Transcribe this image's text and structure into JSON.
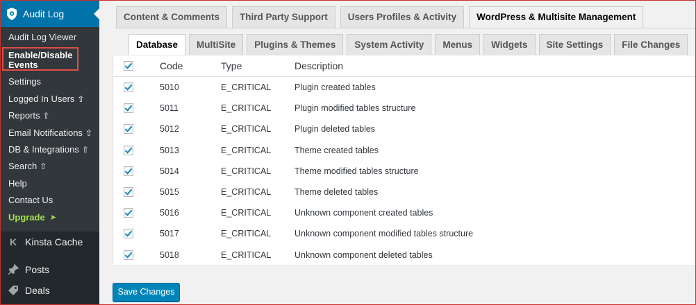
{
  "sidebar": {
    "header": "Audit Log",
    "submenu": [
      {
        "label": "Audit Log Viewer",
        "premium": false
      },
      {
        "label": "Enable/Disable Events",
        "premium": false,
        "active": true
      },
      {
        "label": "Settings",
        "premium": false
      },
      {
        "label": "Logged In Users",
        "premium": true
      },
      {
        "label": "Reports",
        "premium": true
      },
      {
        "label": "Email Notifications",
        "premium": true
      },
      {
        "label": "DB & Integrations",
        "premium": true
      },
      {
        "label": "Search",
        "premium": true
      },
      {
        "label": "Help",
        "premium": false
      },
      {
        "label": "Contact Us",
        "premium": false
      },
      {
        "label": "Upgrade",
        "premium": false,
        "upgrade": true
      }
    ],
    "kinsta": "Kinsta Cache",
    "posts": "Posts",
    "deals": "Deals"
  },
  "main_tabs": [
    {
      "label": "Content & Comments",
      "active": false
    },
    {
      "label": "Third Party Support",
      "active": false
    },
    {
      "label": "Users Profiles & Activity",
      "active": false
    },
    {
      "label": "WordPress & Multisite Management",
      "active": true
    }
  ],
  "sub_tabs": [
    {
      "label": "Database",
      "active": true
    },
    {
      "label": "MultiSite",
      "active": false
    },
    {
      "label": "Plugins & Themes",
      "active": false
    },
    {
      "label": "System Activity",
      "active": false
    },
    {
      "label": "Menus",
      "active": false
    },
    {
      "label": "Widgets",
      "active": false
    },
    {
      "label": "Site Settings",
      "active": false
    },
    {
      "label": "File Changes",
      "active": false
    }
  ],
  "table": {
    "headers": {
      "code": "Code",
      "type": "Type",
      "description": "Description"
    },
    "rows": [
      {
        "code": "5010",
        "type": "E_CRITICAL",
        "description": "Plugin created tables",
        "checked": true
      },
      {
        "code": "5011",
        "type": "E_CRITICAL",
        "description": "Plugin modified tables structure",
        "checked": true
      },
      {
        "code": "5012",
        "type": "E_CRITICAL",
        "description": "Plugin deleted tables",
        "checked": true
      },
      {
        "code": "5013",
        "type": "E_CRITICAL",
        "description": "Theme created tables",
        "checked": true
      },
      {
        "code": "5014",
        "type": "E_CRITICAL",
        "description": "Theme modified tables structure",
        "checked": true
      },
      {
        "code": "5015",
        "type": "E_CRITICAL",
        "description": "Theme deleted tables",
        "checked": true
      },
      {
        "code": "5016",
        "type": "E_CRITICAL",
        "description": "Unknown component created tables",
        "checked": true
      },
      {
        "code": "5017",
        "type": "E_CRITICAL",
        "description": "Unknown component modified tables structure",
        "checked": true
      },
      {
        "code": "5018",
        "type": "E_CRITICAL",
        "description": "Unknown component deleted tables",
        "checked": true
      }
    ]
  },
  "save_button": "Save Changes",
  "colors": {
    "sidebar_bg": "#23282d",
    "submenu_bg": "#32373c",
    "active_blue": "#0073aa",
    "button_blue": "#0085ba",
    "highlight_red": "#e14d43",
    "upgrade_green": "#a4e04f",
    "check_blue": "#1e8cbe"
  },
  "icons": {
    "audit_log": "shield-icon",
    "premium": "arrow-up-outline-icon",
    "upgrade": "triangle-right-icon",
    "kinsta": "kinsta-k-icon",
    "posts": "pushpin-icon",
    "deals": "tag-icon",
    "check": "checkmark-icon"
  }
}
